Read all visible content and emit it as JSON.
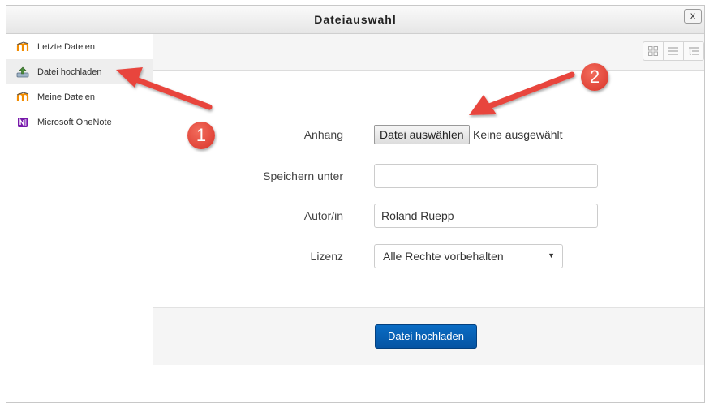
{
  "dialog": {
    "title": "Dateiauswahl",
    "close_label": "x"
  },
  "sidebar": {
    "items": [
      {
        "label": "Letzte Dateien",
        "icon": "moodle-icon"
      },
      {
        "label": "Datei hochladen",
        "icon": "upload-icon",
        "active": true
      },
      {
        "label": "Meine Dateien",
        "icon": "moodle-icon"
      },
      {
        "label": "Microsoft OneNote",
        "icon": "onenote-icon"
      }
    ]
  },
  "toolbar": {
    "view_buttons": [
      "grid-view-icon",
      "list-view-icon",
      "tree-view-icon"
    ]
  },
  "form": {
    "attachment_label": "Anhang",
    "choose_file_label": "Datei auswählen",
    "no_file_text": "Keine ausgewählt",
    "save_as_label": "Speichern unter",
    "save_as_value": "",
    "author_label": "Autor/in",
    "author_value": "Roland Ruepp",
    "license_label": "Lizenz",
    "license_value": "Alle Rechte vorbehalten"
  },
  "footer": {
    "upload_button": "Datei hochladen"
  },
  "annotations": {
    "badge_1": "1",
    "badge_2": "2",
    "arrow_color": "#e8453c"
  }
}
